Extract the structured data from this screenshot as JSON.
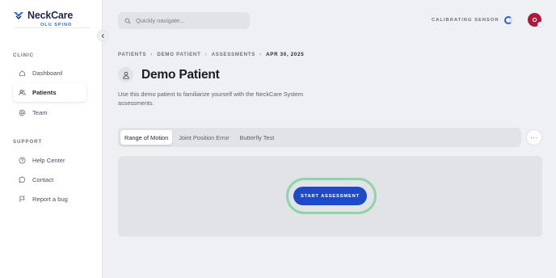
{
  "brand": {
    "name": "NeckCare",
    "subtitle": "OLU SPINO"
  },
  "sidebar": {
    "clinic_label": "CLINIC",
    "clinic_items": [
      {
        "label": "Dashboard",
        "icon": "home-icon"
      },
      {
        "label": "Patients",
        "icon": "users-icon",
        "active": true
      },
      {
        "label": "Team",
        "icon": "at-sign-icon"
      }
    ],
    "support_label": "SUPPORT",
    "support_items": [
      {
        "label": "Help Center",
        "icon": "help-circle-icon"
      },
      {
        "label": "Contact",
        "icon": "chat-bubble-icon"
      },
      {
        "label": "Report a bug",
        "icon": "flag-icon"
      }
    ]
  },
  "search": {
    "placeholder": "Quickly navigate..."
  },
  "status": {
    "text": "CALIBRATING SENSOR"
  },
  "user": {
    "initial": "O"
  },
  "breadcrumb": [
    "PATIENTS",
    "DEMO PATIENT",
    "ASSESSMENTS",
    "APR 30, 2025"
  ],
  "page": {
    "title": "Demo Patient",
    "description": "Use this demo patient to familiarize yourself with the NeckCare System assessments."
  },
  "tabs": [
    {
      "label": "Range of Motion",
      "active": true
    },
    {
      "label": "Joint Position Error"
    },
    {
      "label": "Butterfly Test"
    }
  ],
  "more_label": "···",
  "assessment": {
    "start_label": "START ASSESSMENT"
  },
  "colors": {
    "accent": "#1f49c9",
    "highlight_ring": "#8fd4a9",
    "avatar": "#b0173d",
    "brand_sub": "#2b6be0"
  }
}
